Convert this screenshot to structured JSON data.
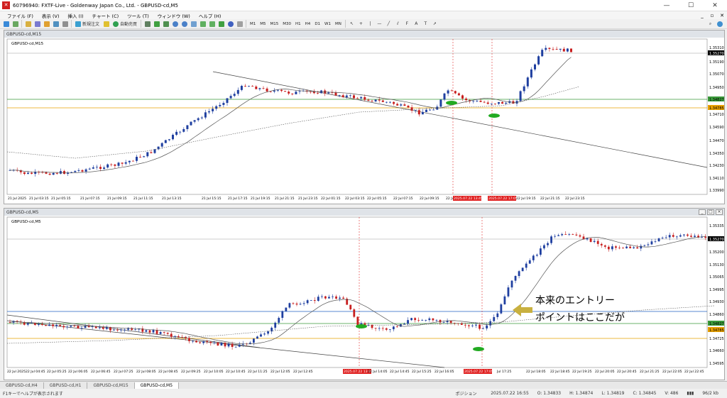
{
  "window": {
    "title": "60796940: FXTF-Live - Goldenway Japan Co., Ltd. - GBPUSD-cd,M5",
    "controls": [
      "—",
      "☐",
      "✕"
    ]
  },
  "menu": {
    "items": [
      "ファイル (F)",
      "表示 (V)",
      "挿入 (I)",
      "チャート (C)",
      "ツール (T)",
      "ウィンドウ (W)",
      "ヘルプ (H)"
    ],
    "right": [
      "_",
      "▫",
      "✕"
    ]
  },
  "toolbar": {
    "new_order": "新規注文",
    "auto_trade": "自動売買",
    "timeframes": [
      "M1",
      "M5",
      "M15",
      "M30",
      "H1",
      "H4",
      "D1",
      "W1",
      "MN"
    ]
  },
  "colors": {
    "bull": "#1f3fa0",
    "bear": "#c81e1e",
    "ma_short": "#555555",
    "ma_long": "#555555",
    "trendline": "#444444",
    "green_line": "#3a9a3a",
    "orange_line": "#e8a000",
    "blue_line": "#2060c0",
    "marker": "#22aa22",
    "annotation_arrow": "#c8b040",
    "vline": "#e03030",
    "bid_line": "#9a9a9a"
  },
  "charts": [
    {
      "title": "GBPUSD-cd,M15",
      "label": "GBPUSD-cd,M15",
      "price_labels": [
        "1.35310",
        "1.35270",
        "1.35190",
        "1.35070",
        "1.34950",
        "1.34827",
        "1.34785",
        "1.34710",
        "1.34590",
        "1.34470",
        "1.34350",
        "1.34230",
        "1.34110",
        "1.33990"
      ],
      "time_labels": [
        "21 Jul 2025",
        "21 Jul 03:15",
        "21 Jul 05:15",
        "21 Jul 07:15",
        "21 Jul 09:15",
        "21 Jul 11:15",
        "21 Jul 13:15",
        "21 Jul 15:15",
        "21 Jul 17:15",
        "21 Jul 19:15",
        "21 Jul 21:15",
        "21 Jul 23:15",
        "22 Jul 01:15",
        "22 Jul 03:15",
        "22 Jul 05:15",
        "22 Jul 07:15",
        "22 Jul 09:15",
        "22 Jul 11:",
        "2025.07.22 13:45",
        "2025.07.22 17:05",
        "22 Jul 19:15",
        "22 Jul 21:15",
        "22 Jul 23:15"
      ]
    },
    {
      "title": "GBPUSD-cd,M5",
      "label": "GBPUSD-cd,M5",
      "price_labels": [
        "1.35335",
        "1.35270",
        "1.35200",
        "1.35130",
        "1.35065",
        "1.34995",
        "1.34930",
        "1.34860",
        "1.34827",
        "1.34785",
        "1.34725",
        "1.34660",
        "1.34595"
      ],
      "time_labels": [
        "22 Jul 2025",
        "22 Jul 04:45",
        "22 Jul 05:25",
        "22 Jul 06:05",
        "22 Jul 06:45",
        "22 Jul 07:25",
        "22 Jul 08:05",
        "22 Jul 08:45",
        "22 Jul 09:25",
        "22 Jul 10:05",
        "22 Jul 10:45",
        "22 Jul 11:25",
        "22 Jul 12:05",
        "22 Jul 12:45",
        "2025.07.22 13:45",
        "22 Jul 14:05",
        "22 Jul 14:45",
        "22 Jul 15:25",
        "22 Jul 16:05",
        "2025.07.22 17:05",
        "Jul 17:25",
        "22 Jul 18:05",
        "22 Jul 18:45",
        "22 Jul 19:25",
        "22 Jul 20:05",
        "22 Jul 20:45",
        "22 Jul 21:25",
        "22 Jul 22:05",
        "22 Jul 22:45"
      ],
      "annotation_lines": [
        "本来のエントリー",
        "ポイントはここだが"
      ]
    }
  ],
  "tabs": [
    "GBPUSD-cd,H4",
    "GBPUSD-cd,H1",
    "GBPUSD-cd,M15",
    "GBPUSD-cd,M5"
  ],
  "active_tab": 3,
  "status": {
    "help": "F1キーでヘルプが表示されます",
    "profile": "ポジション",
    "datetime": "2025.07.22 16:55",
    "open": "O: 1.34833",
    "high": "H: 1.34874",
    "low": "L: 1.34819",
    "close": "C: 1.34845",
    "volume": "V: 486",
    "bytes": "96/2 kb"
  }
}
